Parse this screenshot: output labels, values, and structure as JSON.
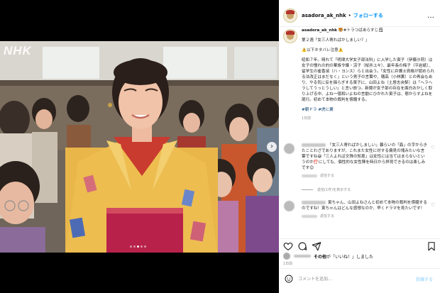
{
  "media": {
    "watermark": "NHK",
    "carousel": {
      "slides": 5,
      "active_index": 2
    }
  },
  "header": {
    "username": "asadora_ak_nhk",
    "separator": "•",
    "follow_label": "フォローする",
    "more_label": "…"
  },
  "caption": {
    "username": "asadora_ak_nhk",
    "title_suffix": "🐯#トラつばあらすじ🗒",
    "heading": "第２週「女三人寄ればかしましい？」",
    "spoiler": "⚠️以下ネタバレ注意⚠️",
    "body": "昭和７年。晴れて「明律大学女子部法科」に入学した寅子（伊藤沙莉）は女子の憧れの的の華族令嬢・涼子（桜井ユキ）、最年長の梅子（平岩紙）、留学生の崔香淑（ハ・ヨンス）らと出会う。「女性に弁護士資格が認められる法改正はまだなく」という男子の言葉や、穂高（小林薫）との再会もあり、やる気に反を揺らぎする寅子に、山田よね（土居志央梨）は「へラヘラしてうっとうしい」と言い放つ。新聞が女子部の存在を面白おかしく取り上げる中、よね一徳和いよねの言動にひかれた寅子は、懸からすよねを尾行。初めて本物の裁判を傍聴する。",
    "hashtags": "#朝ドラ #虎に翼",
    "time": "1日前"
  },
  "comments": [
    {
      "text": "「女三人寄ればかしましい」暮らいの「姦」の字からきたことわざでありますが、これまた女性に対する偏見の塊みたいな言葉ですね😅「三人よれば文殊の知恵」は女性には当てはまらないというのか⁉️にしても、個性的な女性陣を時日から拝見できるのは楽しみです😊",
      "time": "1日前",
      "likes": "「いいね！」",
      "reply": "返信する"
    },
    {
      "text": "寅ちゃん、山田よねさんと初めて本物の裁判を傍聴するのですね！寅ちゃんはどんな感想なのか、早くドラマを見たいです！",
      "time": "1日前",
      "likes": "「いいね！」",
      "reply": "返信する"
    }
  ],
  "reply_toggle": {
    "label": "返信(1件)を表示する"
  },
  "likes": {
    "joiner": "その他",
    "text": "が「いいね！」しました"
  },
  "post_time": "1日前",
  "comment_box": {
    "placeholder": "コメントを追加...",
    "post_label": "投稿する"
  },
  "colors": {
    "link_blue": "#0095f6",
    "hashtag_blue": "#00376b",
    "muted_gray": "#8e8e8e"
  }
}
